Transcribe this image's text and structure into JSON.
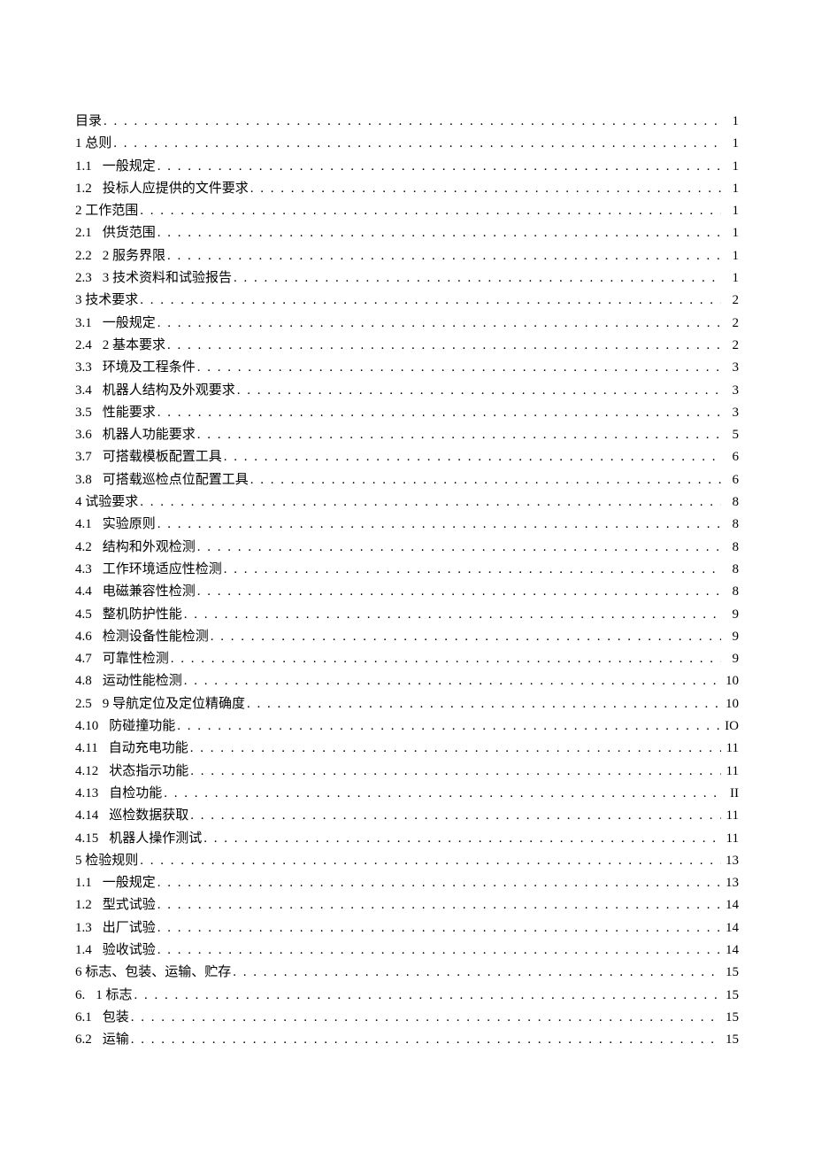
{
  "toc": [
    {
      "num": "",
      "title": "目录",
      "page": "1",
      "noIndent": true
    },
    {
      "num": "",
      "title": "1 总则",
      "page": "1",
      "noIndent": true
    },
    {
      "num": "1.1",
      "title": "一般规定",
      "page": "1"
    },
    {
      "num": "1.2",
      "title": "投标人应提供的文件要求",
      "page": "1"
    },
    {
      "num": "",
      "title": "2 工作范围",
      "page": "1",
      "noIndent": true
    },
    {
      "num": "2.1",
      "title": "供货范围",
      "page": "1"
    },
    {
      "num": "2.2",
      "title": "2 服务界限",
      "page": "1"
    },
    {
      "num": "2.3",
      "title": "3 技术资料和试验报告",
      "page": "1"
    },
    {
      "num": "",
      "title": "3 技术要求",
      "page": "2",
      "noIndent": true
    },
    {
      "num": "3.1",
      "title": "一般规定",
      "page": "2"
    },
    {
      "num": "2.4",
      "title": "2 基本要求",
      "page": "2"
    },
    {
      "num": "3.3",
      "title": "环境及工程条件",
      "page": "3"
    },
    {
      "num": "3.4",
      "title": "机器人结构及外观要求",
      "page": "3"
    },
    {
      "num": "3.5",
      "title": "性能要求",
      "page": "3"
    },
    {
      "num": "3.6",
      "title": "机器人功能要求",
      "page": "5"
    },
    {
      "num": "3.7",
      "title": "可搭载模板配置工具",
      "page": "6"
    },
    {
      "num": "3.8",
      "title": "可搭载巡检点位配置工具",
      "page": "6"
    },
    {
      "num": "",
      "title": "4 试验要求",
      "page": "8",
      "noIndent": true
    },
    {
      "num": "4.1",
      "title": "实验原则",
      "page": "8"
    },
    {
      "num": "4.2",
      "title": "结构和外观检测",
      "page": "8"
    },
    {
      "num": "4.3",
      "title": "工作环境适应性检测",
      "page": "8"
    },
    {
      "num": "4.4",
      "title": "电磁兼容性检测",
      "page": "8"
    },
    {
      "num": "4.5",
      "title": "整机防护性能",
      "page": "9"
    },
    {
      "num": "4.6",
      "title": "检测设备性能检测",
      "page": "9"
    },
    {
      "num": "4.7",
      "title": "可靠性检测",
      "page": "9"
    },
    {
      "num": "4.8",
      "title": "运动性能检测",
      "page": "10"
    },
    {
      "num": "2.5",
      "title": "9 导航定位及定位精确度",
      "page": "10"
    },
    {
      "num": "4.10",
      "title": "防碰撞功能",
      "page": "IO"
    },
    {
      "num": "4.11",
      "title": "自动充电功能",
      "page": "11"
    },
    {
      "num": "4.12",
      "title": "状态指示功能",
      "page": "11"
    },
    {
      "num": "4.13",
      "title": "自检功能",
      "page": "II"
    },
    {
      "num": "4.14",
      "title": "巡检数据获取",
      "page": "11"
    },
    {
      "num": "4.15",
      "title": "机器人操作测试",
      "page": "11"
    },
    {
      "num": "",
      "title": "5 检验规则",
      "page": "13",
      "noIndent": true
    },
    {
      "num": "1.1",
      "title": "一般规定",
      "page": "13"
    },
    {
      "num": "1.2",
      "title": "型式试验",
      "page": "14"
    },
    {
      "num": "1.3",
      "title": "出厂试验",
      "page": "14"
    },
    {
      "num": "1.4",
      "title": "验收试验",
      "page": "14"
    },
    {
      "num": "",
      "title": "6 标志、包装、运输、贮存",
      "page": "15",
      "noIndent": true
    },
    {
      "num": "6.",
      "title": "1 标志",
      "page": "15"
    },
    {
      "num": "6.1",
      "title": "包装",
      "page": "15"
    },
    {
      "num": "6.2",
      "title": "运输",
      "page": "15"
    }
  ]
}
